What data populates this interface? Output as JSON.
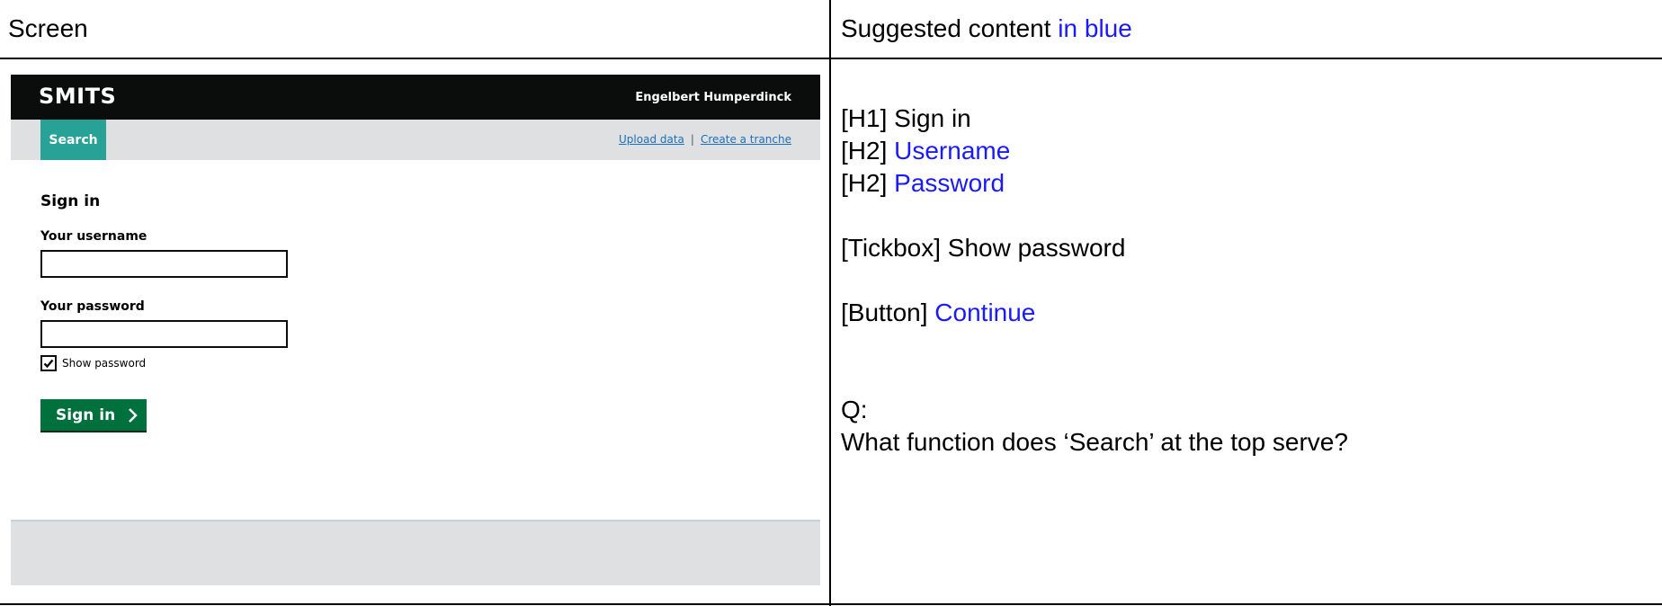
{
  "table": {
    "col1_header": "Screen",
    "col2_header_prefix": "Suggested content ",
    "col2_header_blue": "in blue"
  },
  "app": {
    "logo": "SMITS",
    "user_name": "Engelbert Humperdinck",
    "search_tab": "Search",
    "nav_link_upload": "Upload data",
    "nav_separator": "|",
    "nav_link_tranche": "Create a tranche",
    "page_title": "Sign in",
    "username_label": "Your username",
    "username_value": "",
    "password_label": "Your password",
    "password_value": "",
    "show_password_label": "Show password",
    "show_password_checked": true,
    "signin_button": "Sign in"
  },
  "notes": {
    "h1_prefix": "[H1] ",
    "h1_text": "Sign in",
    "h2a_prefix": "[H2] ",
    "h2a_text": "Username",
    "h2b_prefix": "[H2] ",
    "h2b_text": "Password",
    "tickbox_prefix": "[Tickbox] ",
    "tickbox_text": "Show password",
    "button_prefix": "[Button] ",
    "button_text": "Continue",
    "question_label": "Q:",
    "question_text": "What function does ‘Search’ at the top serve?"
  },
  "colors": {
    "topbar": "#0b0c0c",
    "search_tab": "#28a197",
    "button": "#00703c",
    "suggested": "#1a1aff"
  },
  "icons": {
    "checkbox": "check-icon",
    "button_arrow": "chevron-right-icon"
  }
}
